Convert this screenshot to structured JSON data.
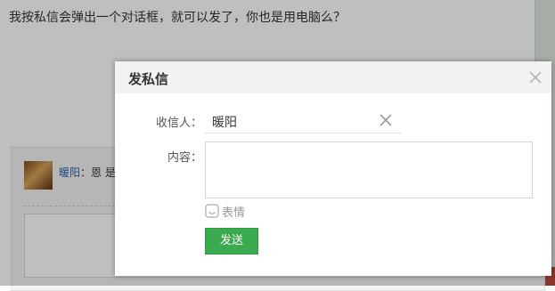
{
  "background": {
    "question_text": "我按私信会弹出一个对话框，就可以发了，你也是用电脑么？",
    "reply_username": "暖阳",
    "reply_text": "：恩 是",
    "avatar_icon": "user-avatar-photo",
    "overlay_color": "#00000040"
  },
  "dialog": {
    "title": "发私信",
    "close_icon": "close-icon",
    "recipient_label": "收信人：",
    "recipient_value": "暖阳",
    "recipient_clear_icon": "clear-icon",
    "content_label": "内容：",
    "content_value": "",
    "emoji_icon": "emoji-icon",
    "emoji_label": "表情",
    "send_label": "发送",
    "accent_color": "#3aaa4f"
  }
}
